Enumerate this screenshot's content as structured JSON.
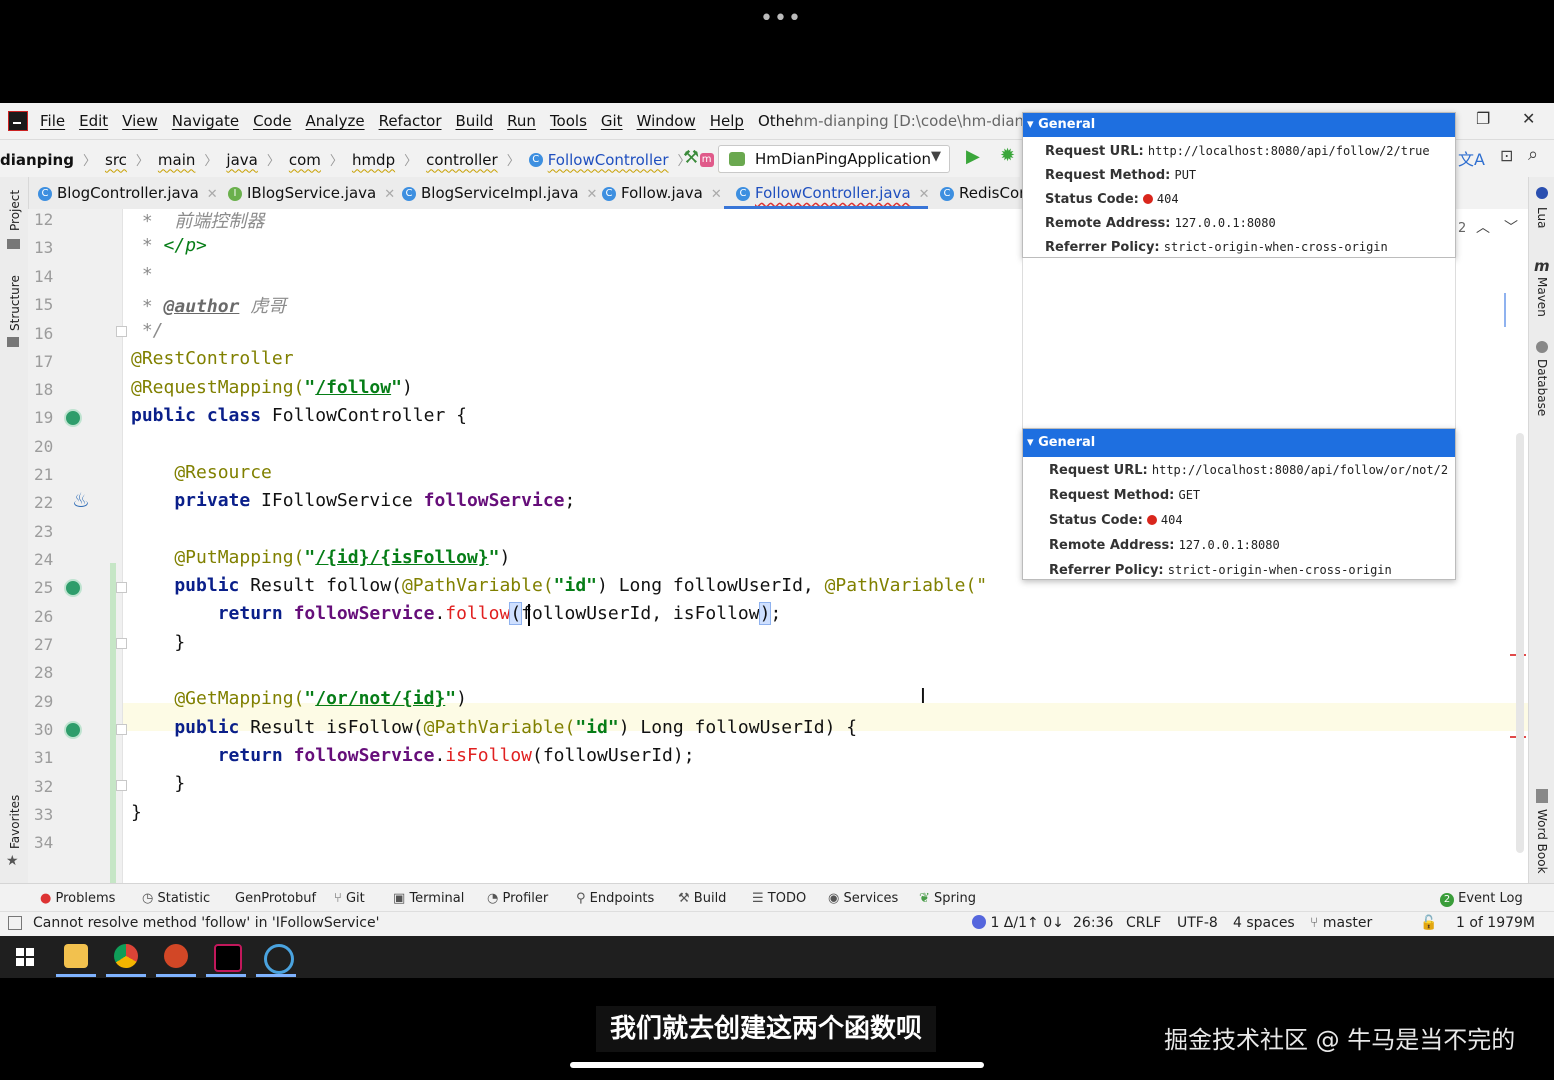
{
  "menu": {
    "items": [
      "File",
      "Edit",
      "View",
      "Navigate",
      "Code",
      "Analyze",
      "Refactor",
      "Build",
      "Run",
      "Tools",
      "Git",
      "Window",
      "Help",
      "Other"
    ],
    "window_title": "hm-dianping [D:\\code\\hm-dianpi"
  },
  "breadcrumb": {
    "items": [
      "dianping",
      "src",
      "main",
      "java",
      "com",
      "hmdp",
      "controller"
    ],
    "class_name": "FollowController",
    "method_name": "follow"
  },
  "run_config": "HmDianPingApplication",
  "tabs": [
    "BlogController.java",
    "IBlogService.java",
    "BlogServiceImpl.java",
    "Follow.java",
    "FollowController.java",
    "RedisCor"
  ],
  "tab_icons": [
    "C",
    "I",
    "C",
    "C",
    "C",
    "C"
  ],
  "left_strip": [
    "Project",
    "Structure",
    "Favorites"
  ],
  "right_strip": [
    "Lua",
    "Maven",
    "Database",
    "Word Book"
  ],
  "editor": {
    "line_numbers": [
      "12",
      "13",
      "14",
      "15",
      "16",
      "17",
      "18",
      "19",
      "20",
      "21",
      "22",
      "23",
      "24",
      "25",
      "26",
      "27",
      "28",
      "29",
      "30",
      "31",
      "32",
      "33",
      "34"
    ],
    "lines": {
      "l12": {
        "a": " *  ",
        "b": "前端控制器"
      },
      "l13": {
        "a": " * ",
        "b": "</p>"
      },
      "l14": {
        "a": " *"
      },
      "l15": {
        "a": " * ",
        "b": "@author",
        "c": " 虎哥"
      },
      "l16": {
        "a": " */"
      },
      "l17": {
        "a": "@RestController"
      },
      "l18": {
        "a": "@RequestMapping(",
        "b": "\"",
        "c": "/follow",
        "d": "\"",
        "e": ")"
      },
      "l19": {
        "a": "public class ",
        "b": "FollowController {"
      },
      "l21": {
        "a": "    @Resource"
      },
      "l22": {
        "a": "    private ",
        "b": "IFollowService ",
        "c": "followService",
        "d": ";"
      },
      "l24": {
        "a": "    @PutMapping(",
        "b": "\"",
        "c": "/{id}/{isFollow}",
        "d": "\"",
        "e": ")"
      },
      "l25": {
        "a": "    public ",
        "b": "Result follow(",
        "c": "@PathVariable(",
        "d": "\"id\"",
        "e": ") Long followUserId, ",
        "f": "@PathVariable(\""
      },
      "l26": {
        "a": "        return ",
        "b": "followService",
        "c": ".",
        "d": "follow",
        "e": "(",
        "f": "followUserId, isFollow",
        "g": ")",
        "h": ";"
      },
      "l27": {
        "a": "    }"
      },
      "l29": {
        "a": "    @GetMapping(",
        "b": "\"",
        "c": "/or/not/{id}",
        "d": "\"",
        "e": ")"
      },
      "l30": {
        "a": "    public ",
        "b": "Result isFollow(",
        "c": "@PathVariable(",
        "d": "\"id\"",
        "e": ") Long followUserId) {"
      },
      "l31": {
        "a": "        return ",
        "b": "followService",
        "c": ".",
        "d": "isFollow",
        "e": "(followUserId);"
      },
      "l32": {
        "a": "    }"
      },
      "l33": {
        "a": "}"
      }
    },
    "counter": "2"
  },
  "popups": [
    {
      "header": "General",
      "rows": [
        {
          "k": "Request URL:",
          "v": "http://localhost:8080/api/follow/2/true"
        },
        {
          "k": "Request Method:",
          "v": "PUT"
        },
        {
          "k": "Status Code:",
          "v": "404"
        },
        {
          "k": "Remote Address:",
          "v": "127.0.0.1:8080"
        },
        {
          "k": "Referrer Policy:",
          "v": "strict-origin-when-cross-origin"
        }
      ]
    },
    {
      "header": "General",
      "rows": [
        {
          "k": "Request URL:",
          "v": "http://localhost:8080/api/follow/or/not/2"
        },
        {
          "k": "Request Method:",
          "v": "GET"
        },
        {
          "k": "Status Code:",
          "v": "404"
        },
        {
          "k": "Remote Address:",
          "v": "127.0.0.1:8080"
        },
        {
          "k": "Referrer Policy:",
          "v": "strict-origin-when-cross-origin"
        }
      ]
    }
  ],
  "tool_windows": [
    "Problems",
    "Statistic",
    "GenProtobuf",
    "Git",
    "Terminal",
    "Profiler",
    "Endpoints",
    "Build",
    "TODO",
    "Services",
    "Spring",
    "Event Log"
  ],
  "status": {
    "message": "Cannot resolve method 'follow' in 'IFollowService'",
    "vcs": "1 Δ/1↑ 0↓",
    "position": "26:36",
    "line_sep": "CRLF",
    "encoding": "UTF-8",
    "indent": "4 spaces",
    "branch": "master",
    "memory": "1 of 1979M",
    "event_count": "2"
  },
  "subtitle": "我们就去创建这两个函数呗",
  "watermark": "掘金技术社区 @ 牛马是当不完的"
}
